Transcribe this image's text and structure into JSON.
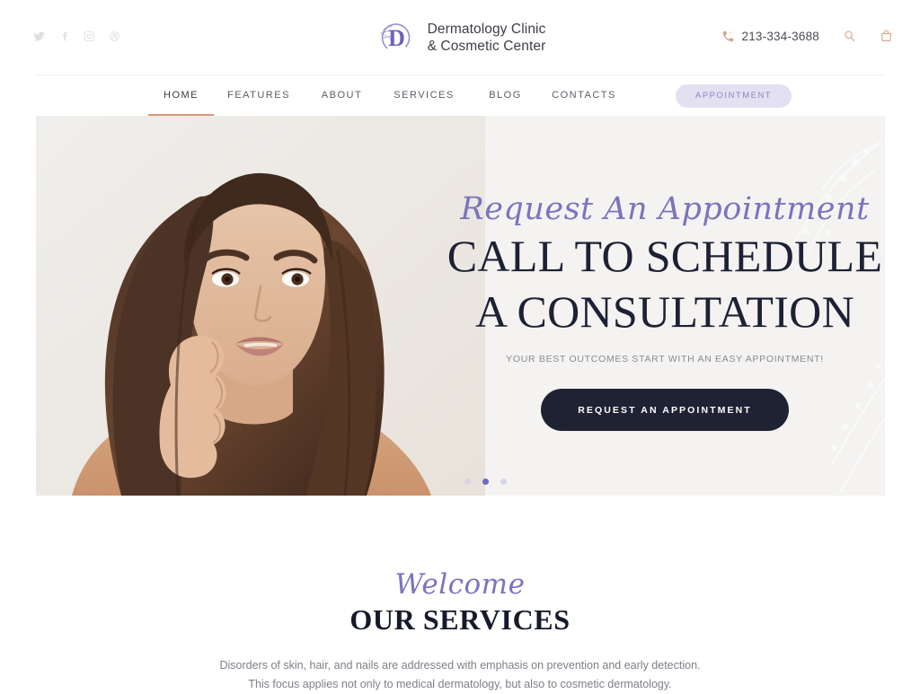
{
  "header": {
    "socials": [
      {
        "name": "twitter-icon",
        "label": "Twitter"
      },
      {
        "name": "facebook-icon",
        "label": "Facebook"
      },
      {
        "name": "instagram-icon",
        "label": "Instagram"
      },
      {
        "name": "dribbble-icon",
        "label": "Dribbble"
      }
    ],
    "brand": {
      "monogram": "D",
      "name": "Dermatology Clinic\n& Cosmetic Center"
    },
    "phone": "213-334-3688",
    "phone_icon": "phone-ring-icon",
    "search_icon": "search-icon",
    "cart_icon": "shopping-bag-icon"
  },
  "nav": {
    "items": [
      {
        "label": "HOME",
        "active": true
      },
      {
        "label": "FEATURES",
        "active": false
      },
      {
        "label": "ABOUT",
        "active": false
      },
      {
        "label": "SERVICES",
        "active": false
      },
      {
        "label": "BLOG",
        "active": false
      },
      {
        "label": "CONTACTS",
        "active": false
      }
    ],
    "appointment_label": "APPOINTMENT"
  },
  "hero": {
    "script": "Request An Appointment",
    "title": "CALL TO SCHEDULE\nA CONSULTATION",
    "subtitle": "YOUR BEST OUTCOMES START WITH AN EASY APPOINTMENT!",
    "cta_label": "REQUEST AN APPOINTMENT",
    "slides": [
      {
        "active": false
      },
      {
        "active": true
      },
      {
        "active": false
      }
    ]
  },
  "services": {
    "script": "Welcome",
    "title": "OUR SERVICES",
    "description": "Disorders of skin, hair, and nails are addressed with emphasis on prevention and early detection.\nThis focus applies not only to medical dermatology, but also to cosmetic dermatology."
  },
  "colors": {
    "accent_purple": "#7b74bd",
    "pill_bg": "#e3e0f2",
    "dark_navy": "#1e2233",
    "nav_underline": "#d49a72",
    "phone_icon": "#d9a183"
  }
}
